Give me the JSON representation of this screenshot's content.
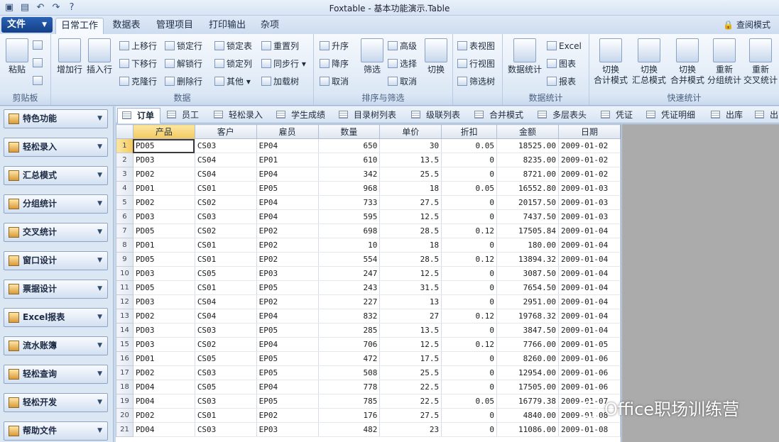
{
  "window": {
    "title": "Foxtable - 基本功能演示.Table"
  },
  "quick_access": {
    "icons": [
      "app-icon",
      "save-icon",
      "undo-icon",
      "redo-icon",
      "help-icon"
    ]
  },
  "menu": {
    "file": "文件",
    "tabs": [
      "日常工作",
      "数据表",
      "管理项目",
      "打印输出",
      "杂项"
    ],
    "mode": "查阅模式"
  },
  "ribbon": {
    "clipboard": {
      "label": "剪贴板",
      "paste": "粘贴"
    },
    "data": {
      "label": "数据",
      "add_row": "增加行",
      "insert_row": "插入行",
      "move_up": "上移行",
      "move_down": "下移行",
      "clone_row": "克隆行",
      "lock_row": "锁定行",
      "unlock_row": "解锁行",
      "delete_row": "删除行",
      "lock_table": "锁定表",
      "lock_col": "锁定列",
      "other": "其他",
      "reset_col": "重置列",
      "sync_row": "同步行",
      "load_tree": "加载树"
    },
    "sort": {
      "label": "排序与筛选",
      "asc": "升序",
      "desc": "降序",
      "cancel": "取消",
      "filter": "筛选",
      "advanced": "高级",
      "select": "选择",
      "cancel2": "取消",
      "switch": "切换"
    },
    "views": {
      "table_view": "表视图",
      "row_view": "行视图",
      "filter_tree": "筛选树"
    },
    "stats": {
      "label": "数据统计",
      "data_stats": "数据统计",
      "excel": "Excel",
      "chart": "图表",
      "report": "报表"
    },
    "quick": {
      "label": "快速统计",
      "b1a": "切换",
      "b1b": "合计模式",
      "b2a": "切换",
      "b2b": "汇总模式",
      "b3a": "切换",
      "b3b": "合并模式",
      "b4a": "重新",
      "b4b": "分组统计",
      "b5a": "重新",
      "b5b": "交叉统计"
    }
  },
  "sidebar": {
    "items": [
      "特色功能",
      "轻松录入",
      "汇总模式",
      "分组统计",
      "交叉统计",
      "窗口设计",
      "票据设计",
      "Excel报表",
      "流水账簿",
      "轻松查询",
      "轻松开发",
      "帮助文件"
    ]
  },
  "sheet_tabs": [
    "订单",
    "员工",
    "轻松录入",
    "学生成绩",
    "目录树列表",
    "级联列表",
    "合并模式",
    "多层表头",
    "凭证",
    "凭证明细",
    "出库",
    "出"
  ],
  "table": {
    "columns": [
      "产品",
      "客户",
      "雇员",
      "数量",
      "单价",
      "折扣",
      "金额",
      "日期"
    ],
    "rows": [
      [
        "1",
        "PD05",
        "CS03",
        "EP04",
        "650",
        "30",
        "0.05",
        "18525.00",
        "2009-01-02"
      ],
      [
        "2",
        "PD03",
        "CS04",
        "EP01",
        "610",
        "13.5",
        "0",
        "8235.00",
        "2009-01-02"
      ],
      [
        "3",
        "PD02",
        "CS04",
        "EP04",
        "342",
        "25.5",
        "0",
        "8721.00",
        "2009-01-02"
      ],
      [
        "4",
        "PD01",
        "CS01",
        "EP05",
        "968",
        "18",
        "0.05",
        "16552.80",
        "2009-01-03"
      ],
      [
        "5",
        "PD02",
        "CS02",
        "EP04",
        "733",
        "27.5",
        "0",
        "20157.50",
        "2009-01-03"
      ],
      [
        "6",
        "PD03",
        "CS03",
        "EP04",
        "595",
        "12.5",
        "0",
        "7437.50",
        "2009-01-03"
      ],
      [
        "7",
        "PD05",
        "CS02",
        "EP02",
        "698",
        "28.5",
        "0.12",
        "17505.84",
        "2009-01-04"
      ],
      [
        "8",
        "PD01",
        "CS01",
        "EP02",
        "10",
        "18",
        "0",
        "180.00",
        "2009-01-04"
      ],
      [
        "9",
        "PD05",
        "CS01",
        "EP02",
        "554",
        "28.5",
        "0.12",
        "13894.32",
        "2009-01-04"
      ],
      [
        "10",
        "PD03",
        "CS05",
        "EP03",
        "247",
        "12.5",
        "0",
        "3087.50",
        "2009-01-04"
      ],
      [
        "11",
        "PD05",
        "CS01",
        "EP05",
        "243",
        "31.5",
        "0",
        "7654.50",
        "2009-01-04"
      ],
      [
        "12",
        "PD03",
        "CS04",
        "EP02",
        "227",
        "13",
        "0",
        "2951.00",
        "2009-01-04"
      ],
      [
        "13",
        "PD02",
        "CS04",
        "EP04",
        "832",
        "27",
        "0.12",
        "19768.32",
        "2009-01-04"
      ],
      [
        "14",
        "PD03",
        "CS03",
        "EP05",
        "285",
        "13.5",
        "0",
        "3847.50",
        "2009-01-04"
      ],
      [
        "15",
        "PD03",
        "CS02",
        "EP04",
        "706",
        "12.5",
        "0.12",
        "7766.00",
        "2009-01-05"
      ],
      [
        "16",
        "PD01",
        "CS05",
        "EP05",
        "472",
        "17.5",
        "0",
        "8260.00",
        "2009-01-06"
      ],
      [
        "17",
        "PD02",
        "CS03",
        "EP05",
        "508",
        "25.5",
        "0",
        "12954.00",
        "2009-01-06"
      ],
      [
        "18",
        "PD04",
        "CS05",
        "EP04",
        "778",
        "22.5",
        "0",
        "17505.00",
        "2009-01-06"
      ],
      [
        "19",
        "PD04",
        "CS03",
        "EP05",
        "785",
        "22.5",
        "0.05",
        "16779.38",
        "2009-01-07"
      ],
      [
        "20",
        "PD02",
        "CS01",
        "EP02",
        "176",
        "27.5",
        "0",
        "4840.00",
        "2009-01-08"
      ],
      [
        "21",
        "PD04",
        "CS03",
        "EP03",
        "482",
        "23",
        "0",
        "11086.00",
        "2009-01-08"
      ]
    ]
  },
  "watermark": {
    "text": "Office职场训练营"
  }
}
